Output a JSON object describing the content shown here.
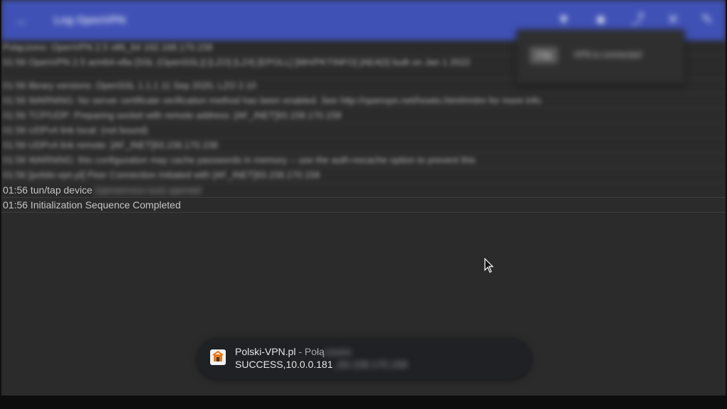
{
  "toolbar": {
    "title": "Log OpenVPN",
    "icons": [
      "arrow-back-icon",
      "filter-icon",
      "save-icon",
      "share-icon",
      "close-icon",
      "edit-icon"
    ]
  },
  "popup": {
    "chip_label": "Clip",
    "message": "VPN is connected"
  },
  "log": {
    "blurred_lines": [
      "Polączono: OpenVPN 2.5 x86_64 192.168.170.158",
      "01:56 OpenVPN 2.5 arm64-v8a [SSL (OpenSSL)] [LZO] [LZ4] [EPOLL] [MH/PKTINFO] [AEAD] built on Jan 1 2022",
      "01:56 library versions: OpenSSL 1.1.1 11 Sep 2020, LZO 2.10",
      "01:56 WARNING: No server certificate verification method has been enabled. See http://openvpn.net/howto.html#mitm for more info.",
      "01:56 TCP/UDP: Preparing socket with remote address: [AF_INET]93.158.170.158",
      "01:56 UDPv4 link local: (not bound)",
      "01:56 UDPv4 link remote: [AF_INET]93.158.170.158",
      "01:56 WARNING: this configuration may cache passwords in memory -- use the auth-nocache option to prevent this",
      "01:56 [polski-vpn.pl] Peer Connection Initiated with [AF_INET]93.158.170.158"
    ],
    "line_tuntap_prefix": "01:56 tun/tap device ",
    "line_tuntap_blur": "[vpnservice-tun] opened",
    "line_completed": "01:56 Initialization Sequence Completed"
  },
  "toast": {
    "app_icon": "openvpn-app-icon",
    "title": "Polski-VPN.pl",
    "separator": " - ",
    "status_prefix": "Połą",
    "status_blur": "czono",
    "detail_prefix": "SUCCESS,10.0.0.181",
    "detail_blur": ",,93.158.170.158"
  },
  "colors": {
    "toolbar": "#3f51b5",
    "background": "#2b2b2b",
    "toast": "#1f2125"
  }
}
